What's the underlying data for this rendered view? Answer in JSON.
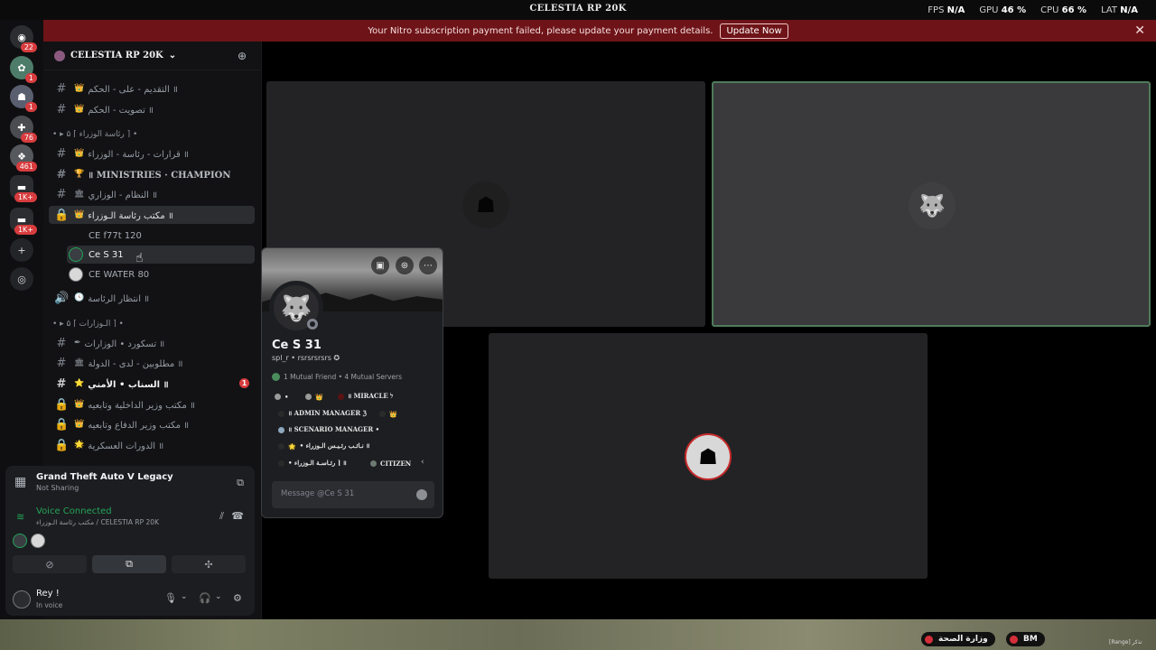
{
  "titlebar": {
    "title": "CELESTIA RP 20K",
    "fps_label": "FPS",
    "fps_value": "N/A",
    "gpu_label": "GPU",
    "gpu_value": "46 %",
    "cpu_label": "CPU",
    "cpu_value": "66 %",
    "lat_label": "LAT",
    "lat_value": "N/A"
  },
  "banner": {
    "text": "Your Nitro subscription payment failed, please update your payment details.",
    "button": "Update Now",
    "close": "✕"
  },
  "rail": {
    "items": [
      {
        "icon": "discord-home-icon",
        "badge": "22"
      },
      {
        "icon": "server-icon",
        "badge": "1"
      },
      {
        "icon": "server-icon",
        "badge": "1"
      },
      {
        "icon": "server-icon",
        "badge": "76"
      },
      {
        "icon": "server-icon",
        "badge": "461"
      },
      {
        "icon": "folder-icon",
        "badge": "1K+"
      },
      {
        "icon": "folder-icon",
        "badge": "1K+"
      },
      {
        "icon": "add-server-icon",
        "badge": ""
      },
      {
        "icon": "discover-icon",
        "badge": ""
      }
    ]
  },
  "server": {
    "name": "CELESTIA RP 20K",
    "chevron": "⌄"
  },
  "channels": {
    "c1": "التقديم - على - الحكم ॥",
    "c2": "تصويت - الحكم ॥",
    "cat1": "• ▸ ۵ ⌈ رئاسة الوزراء ⌉ •",
    "c3": "قرارات - رئاسة - الوزراء ॥",
    "c4": "॥ MINISTRIES · CHAMPION",
    "c5": "النظام - الوزاري ॥",
    "c6": "مكتب رئاسة الـوزراء ॥",
    "voice_users": [
      "CE f77t 120",
      "Ce S 31",
      "CE WATER 80"
    ],
    "c7": "انتظار الرئاسة ॥",
    "cat2": "• ▸ ۵ ⌈ الـوزارات ⌉ •",
    "c8": "تسكورد • الوزارات ॥",
    "c9": "مطلوبين - لدى - الدولة ॥",
    "c10": "السناب • الأمني ॥",
    "c10_badge": "1",
    "c11": "مكتب وزير الداخلية وتابعيه ॥",
    "c12": "مكتب وزير الدفاع وتابعيه ॥",
    "c13": "الدورات العسكرية ॥"
  },
  "activity": {
    "game": "Grand Theft Auto V Legacy",
    "status": "Not Sharing"
  },
  "voice": {
    "title": "Voice Connected",
    "subtitle": "مكتب رئاسة الـوزراء / CELESTIA RP 20K"
  },
  "user": {
    "name": "Rey !",
    "status": "In voice"
  },
  "profile": {
    "display_name": "Ce S 31",
    "username": "spl_r",
    "pronouns": "rsrsrsrsrs",
    "mutual": "1 Mutual Friend • 4 Mutual Servers",
    "roles": [
      "•",
      "",
      "॥ MIRACLE ל",
      "॥ ADMIN MANAGER ℨ",
      "",
      "॥ SCENARIO MANAGER •",
      "• نـائـب رئـيـس الـوزراء ॥",
      "• رئـاسـة الـوزراء ⌉ ॥",
      "CITIZEN"
    ],
    "message_placeholder": "Message @Ce S 31"
  },
  "hud": {
    "ministry": "وزارة الصحة",
    "bm": "BM",
    "watermark": "[Range] تذكر"
  },
  "colors": {
    "accent": "#23a559",
    "alert": "#6e1418",
    "speaking": "#4f7b5a"
  }
}
